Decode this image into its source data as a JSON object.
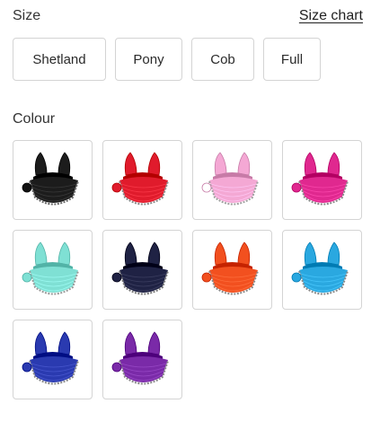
{
  "size": {
    "heading": "Size",
    "chart_link": "Size chart",
    "options": [
      "Shetland",
      "Pony",
      "Cob",
      "Full"
    ]
  },
  "colour": {
    "heading": "Colour",
    "swatches": [
      {
        "name": "black",
        "color": "#1c1c1c",
        "trim": "#6a6a6a",
        "pompom": "#111111"
      },
      {
        "name": "red",
        "color": "#e01b2c",
        "trim": "#8a8a8a",
        "pompom": "#e01b2c"
      },
      {
        "name": "pink",
        "color": "#f4a8d4",
        "trim": "#a0a0a0",
        "pompom": "#ffffff"
      },
      {
        "name": "fuchsia",
        "color": "#e0288f",
        "trim": "#8a8a8a",
        "pompom": "#e0288f"
      },
      {
        "name": "mint",
        "color": "#7fe0d4",
        "trim": "#9a9a9a",
        "pompom": "#7fe0d4"
      },
      {
        "name": "navy",
        "color": "#1f2244",
        "trim": "#7a7a7a",
        "pompom": "#1f2244"
      },
      {
        "name": "orange",
        "color": "#f2501f",
        "trim": "#8a8a8a",
        "pompom": "#f2501f"
      },
      {
        "name": "sky-blue",
        "color": "#2aa8e0",
        "trim": "#8a8a8a",
        "pompom": "#2aa8e0"
      },
      {
        "name": "royal-blue",
        "color": "#2a3ab0",
        "trim": "#8a8a8a",
        "pompom": "#2a3ab0"
      },
      {
        "name": "purple",
        "color": "#7a2aa8",
        "trim": "#8a8a8a",
        "pompom": "#7a2aa8"
      }
    ]
  }
}
